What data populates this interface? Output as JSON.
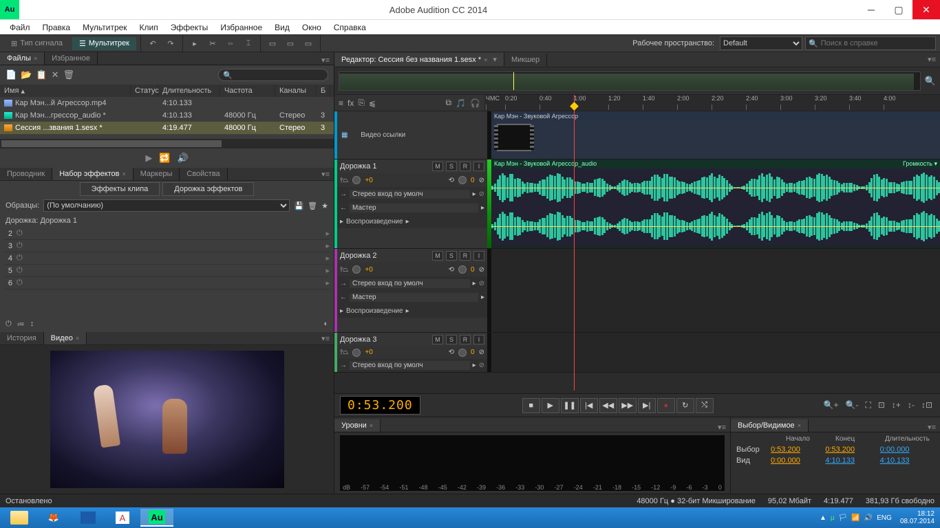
{
  "window": {
    "title": "Adobe Audition CC 2014",
    "app_abbr": "Au"
  },
  "menu": [
    "Файл",
    "Правка",
    "Мультитрек",
    "Клип",
    "Эффекты",
    "Избранное",
    "Вид",
    "Окно",
    "Справка"
  ],
  "toolbar": {
    "mode_wave": "Тип сигнала",
    "mode_mt": "Мультитрек",
    "workspace_label": "Рабочее пространство:",
    "workspace_value": "Default",
    "search_placeholder": "Поиск в справке"
  },
  "files": {
    "tab_files": "Файлы",
    "tab_fav": "Избранное",
    "cols": {
      "name": "Имя",
      "status": "Статус",
      "dur": "Длительность",
      "freq": "Частота",
      "ch": "Каналы",
      "bit": "Б"
    },
    "rows": [
      {
        "type": "video",
        "name": "Кар Мэн...й Агрессор.mp4",
        "dur": "4:10.133",
        "freq": "",
        "ch": "",
        "bit": ""
      },
      {
        "type": "audio",
        "name": "Кар Мэн...грессор_audio *",
        "dur": "4:10.133",
        "freq": "48000 Гц",
        "ch": "Стерео",
        "bit": "3"
      },
      {
        "type": "sesx",
        "name": "Сессия ...звания 1.sesx *",
        "dur": "4:19.477",
        "freq": "48000 Гц",
        "ch": "Стерео",
        "bit": "3",
        "selected": true
      }
    ]
  },
  "effects": {
    "tabs": [
      "Проводник",
      "Набор эффектов",
      "Маркеры",
      "Свойства"
    ],
    "sub_clip": "Эффекты клипа",
    "sub_track": "Дорожка эффектов",
    "preset_label": "Образцы:",
    "preset_value": "(По умолчанию)",
    "track_label": "Дорожка: Дорожка 1",
    "slots": [
      "2",
      "3",
      "4",
      "5",
      "6"
    ]
  },
  "video": {
    "tab_history": "История",
    "tab_video": "Видео"
  },
  "editor": {
    "tab": "Редактор: Сессия без названия 1.sesx *",
    "tab_mixer": "Микшер",
    "ruler_unit": "ЧМС",
    "ticks": [
      "0:20",
      "0:40",
      "1:00",
      "1:20",
      "1:40",
      "2:00",
      "2:20",
      "2:40",
      "3:00",
      "3:20",
      "3:40",
      "4:00"
    ],
    "video_ref": "Видео ссылки",
    "video_clip": "Кар Мэн - Звуковой Агрессор",
    "audio_clip": "Кар Мэн - Звуковой Агрессор_audio",
    "volume": "Громкость",
    "tracks": [
      {
        "name": "Дорожка 1",
        "vol": "+0",
        "pan": "0",
        "input": "Стерео вход по умолч",
        "output": "Мастер",
        "play": "Воспроизведение",
        "color": "green"
      },
      {
        "name": "Дорожка 2",
        "vol": "+0",
        "pan": "0",
        "input": "Стерео вход по умолч",
        "output": "Мастер",
        "play": "Воспроизведение",
        "color": "purple"
      },
      {
        "name": "Дорожка 3",
        "vol": "+0",
        "pan": "0",
        "input": "Стерео вход по умолч",
        "color": "green2"
      }
    ]
  },
  "transport": {
    "timecode": "0:53.200"
  },
  "levels": {
    "tab": "Уровни",
    "ticks": [
      "dB",
      "-57",
      "-54",
      "-51",
      "-48",
      "-45",
      "-42",
      "-39",
      "-36",
      "-33",
      "-30",
      "-27",
      "-24",
      "-21",
      "-18",
      "-15",
      "-12",
      "-9",
      "-6",
      "-3",
      "0"
    ]
  },
  "selview": {
    "tab": "Выбор/Видимое",
    "cols": [
      "Начало",
      "Конец",
      "Длительность"
    ],
    "rows": [
      {
        "lbl": "Выбор",
        "v": [
          "0:53.200",
          "0:53.200",
          "0:00.000"
        ],
        "c": [
          "orange",
          "orange",
          ""
        ]
      },
      {
        "lbl": "Вид",
        "v": [
          "0:00.000",
          "4:10.133",
          "4:10.133"
        ],
        "c": [
          "orange",
          "",
          ""
        ]
      }
    ]
  },
  "status": {
    "left": "Остановлено",
    "format": "48000 Гц ● 32-бит Микширование",
    "size": "95,02 Мбайт",
    "dur": "4:19.477",
    "free": "381,93 Гб свободно"
  },
  "taskbar": {
    "lang": "ENG",
    "time": "18:12",
    "date": "08.07.2014"
  }
}
